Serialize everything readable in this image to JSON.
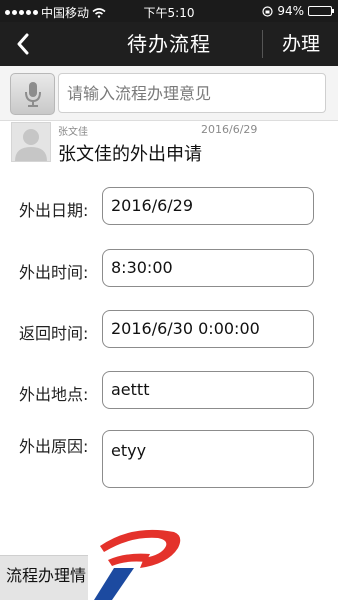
{
  "status_bar": {
    "carrier": "中国移动",
    "time": "下午5:10",
    "battery_text": "94%",
    "battery_level": 0.94
  },
  "header": {
    "title": "待办流程",
    "action_label": "办理"
  },
  "opinion": {
    "placeholder": "请输入流程办理意见"
  },
  "applicant": {
    "name": "张文佳",
    "date": "2016/6/29",
    "title": "张文佳的外出申请"
  },
  "form": {
    "fields": [
      {
        "label": "外出日期:",
        "value": "2016/6/29"
      },
      {
        "label": "外出时间:",
        "value": "8:30:00"
      },
      {
        "label": "返回时间:",
        "value": "2016/6/30 0:00:00"
      },
      {
        "label": "外出地点:",
        "value": "aettt"
      },
      {
        "label": "外出原因:",
        "value": "etyy"
      }
    ]
  },
  "bottom": {
    "tab_label": "流程办理情"
  },
  "colors": {
    "header_bg": "#1f1f1f",
    "logo_red": "#e4322b",
    "logo_blue": "#1c4aa0"
  }
}
